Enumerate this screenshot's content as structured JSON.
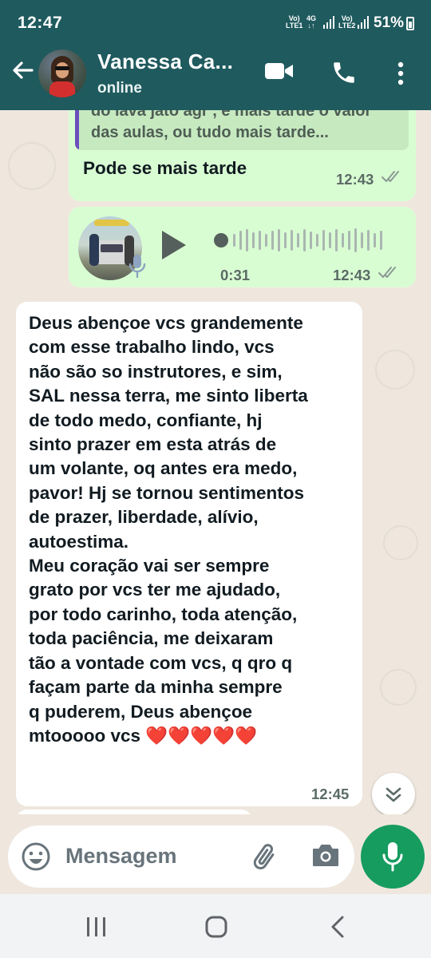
{
  "status_bar": {
    "time": "12:47",
    "sim1_top": "Vo)",
    "sim1_bottom": "LTE1",
    "net": "4G",
    "sim2_top": "Vo)",
    "sim2_bottom": "LTE2",
    "battery": "51%"
  },
  "header": {
    "contact_name": "Vanessa Ca...",
    "contact_status": "online",
    "icons": [
      "back-arrow-icon",
      "video-call-icon",
      "phone-icon",
      "more-vertical-icon"
    ]
  },
  "messages": [
    {
      "direction": "outgoing",
      "quoted_text": "do lava jato agr , é mais tarde o valor das aulas, ou tudo mais tarde...",
      "text": "Pode se mais tarde",
      "time": "12:43",
      "read": true
    },
    {
      "direction": "outgoing",
      "type": "voice",
      "duration": "0:31",
      "time": "12:43",
      "read": true
    },
    {
      "direction": "incoming",
      "text_lines": [
        "Deus abençoe vcs grandemente",
        "com esse trabalho lindo, vcs",
        "não são so instrutores, e sim,",
        "SAL nessa terra, me sinto liberta",
        "de todo medo, confiante, hj",
        "sinto prazer em esta atrás de",
        "um volante, oq antes era medo,",
        "pavor! Hj se tornou sentimentos",
        "de prazer, liberdade, alívio,",
        "autoestima.",
        "Meu coração vai ser sempre",
        "grato por vcs ter me ajudado,",
        "por todo carinho, toda atenção,",
        "toda paciência, me deixaram",
        "tão a vontade com vcs, q qro q",
        "façam parte da minha sempre",
        "q puderem, Deus abençoe",
        "mtooooo vcs ❤️❤️❤️❤️❤️"
      ],
      "time": "12:45"
    }
  ],
  "input": {
    "placeholder": "Mensagem"
  },
  "colors": {
    "header": "#1f5a5e",
    "outgoing_bubble": "#d9fdd3",
    "incoming_bubble": "#ffffff",
    "mic_button": "#169c5f",
    "quote_bar": "#6b4fbb"
  }
}
